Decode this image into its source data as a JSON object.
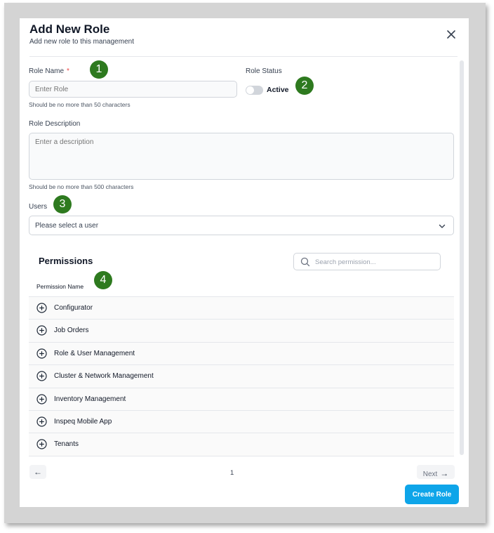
{
  "modal": {
    "title": "Add New Role",
    "subtitle": "Add new role to this management"
  },
  "form": {
    "role_name_label": "Role Name",
    "required_mark": "*",
    "role_name_placeholder": "Enter Role",
    "role_name_hint": "Should be no more than 50 characters",
    "role_status_label": "Role Status",
    "status_toggle_label": "Active",
    "status_toggle_on": false,
    "description_label": "Role Description",
    "description_placeholder": "Enter a description",
    "description_hint": "Should be no more than 500 characters",
    "users_label": "Users",
    "users_placeholder": "Please select a user"
  },
  "badges": [
    "1",
    "2",
    "3",
    "4"
  ],
  "permissions": {
    "title": "Permissions",
    "search_placeholder": "Search permission...",
    "column_header": "Permission Name",
    "items": [
      "Configurator",
      "Job Orders",
      "Role & User Management",
      "Cluster & Network Management",
      "Inventory Management",
      "Inspeq Mobile App",
      "Tenants"
    ]
  },
  "pagination": {
    "prev_label": "←",
    "page": "1",
    "next_label": "Next",
    "next_arrow": "→"
  },
  "actions": {
    "create_label": "Create Role"
  },
  "colors": {
    "badge": "#2e7a1f",
    "primary": "#0ea5e9",
    "required": "#ef4444"
  },
  "icons": {
    "close": "close-icon",
    "chevron": "chevron-down-icon",
    "search": "search-icon",
    "expand": "plus-circle-icon"
  }
}
